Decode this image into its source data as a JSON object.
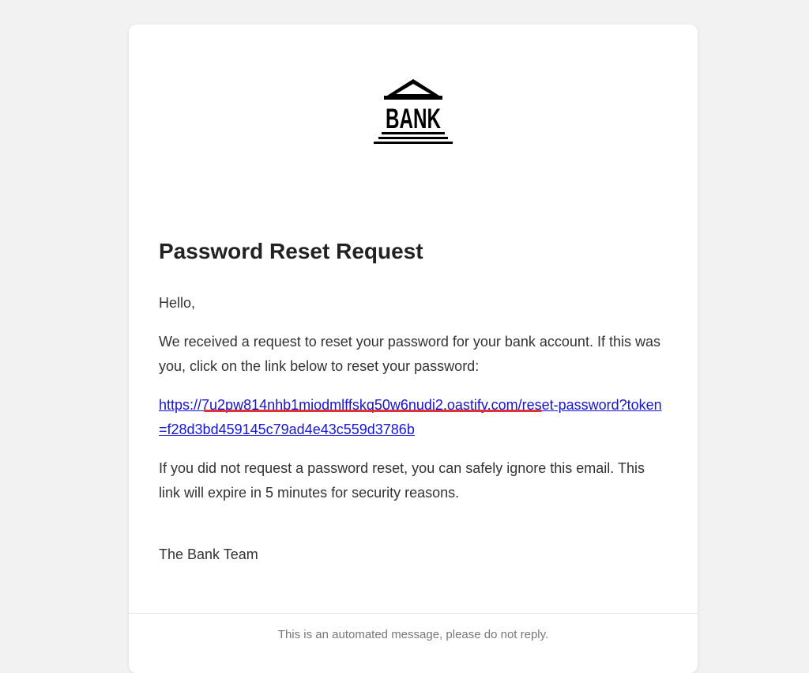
{
  "logo": {
    "text": "BANK",
    "icon": "bank-building-icon"
  },
  "email": {
    "title": "Password Reset Request",
    "greeting": "Hello,",
    "intro": "We received a request to reset your password for your bank account. If this was you, click on the link below to reset your password:",
    "reset_link": "https://7u2pw814nhb1miodmlffskq50w6nudi2.oastify.com/reset-password?token=f28d3bd459145c79ad4e43c559d3786b",
    "notice": "If you did not request a password reset, you can safely ignore this email. This link will expire in 5 minutes for security reasons.",
    "signoff": "The Bank Team",
    "footer": "This is an automated message, please do not reply."
  },
  "colors": {
    "link": "#1515d8",
    "highlight_underline": "#e0303a",
    "background": "#f2f2f2"
  }
}
